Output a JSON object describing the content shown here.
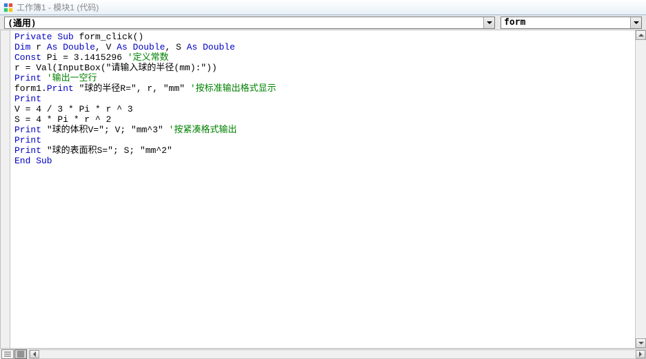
{
  "title": "工作簿1 - 模块1 (代码)",
  "object_dropdown": "(通用)",
  "procedure_dropdown": "form",
  "code_lines": [
    [
      {
        "t": "Private Sub",
        "c": "kw"
      },
      {
        "t": " form_click()",
        "c": ""
      }
    ],
    [
      {
        "t": "Dim",
        "c": "kw"
      },
      {
        "t": " r ",
        "c": ""
      },
      {
        "t": "As Double",
        "c": "kw"
      },
      {
        "t": ", V ",
        "c": ""
      },
      {
        "t": "As Double",
        "c": "kw"
      },
      {
        "t": ", S ",
        "c": ""
      },
      {
        "t": "As Double",
        "c": "kw"
      }
    ],
    [
      {
        "t": "Const",
        "c": "kw"
      },
      {
        "t": " Pi = 3.1415296 ",
        "c": ""
      },
      {
        "t": "'定义常数",
        "c": "cm"
      }
    ],
    [
      {
        "t": "r = Val(InputBox(\"请输入球的半径(mm):\"))",
        "c": ""
      }
    ],
    [
      {
        "t": "Print",
        "c": "kw"
      },
      {
        "t": " ",
        "c": ""
      },
      {
        "t": "'输出一空行",
        "c": "cm"
      }
    ],
    [
      {
        "t": "form1.",
        "c": ""
      },
      {
        "t": "Print",
        "c": "kw"
      },
      {
        "t": " \"球的半径R=\", r, \"mm\" ",
        "c": ""
      },
      {
        "t": "'按标准输出格式显示",
        "c": "cm"
      }
    ],
    [
      {
        "t": "Print",
        "c": "kw"
      }
    ],
    [
      {
        "t": "V = 4 / 3 * Pi * r ^ 3",
        "c": ""
      }
    ],
    [
      {
        "t": "S = 4 * Pi * r ^ 2",
        "c": ""
      }
    ],
    [
      {
        "t": "Print",
        "c": "kw"
      },
      {
        "t": " \"球的体积V=\"; V; \"mm^3\" ",
        "c": ""
      },
      {
        "t": "'按紧凑格式输出",
        "c": "cm"
      }
    ],
    [
      {
        "t": "Print",
        "c": "kw"
      }
    ],
    [
      {
        "t": "Print",
        "c": "kw"
      },
      {
        "t": " \"球的表面积S=\"; S; \"mm^2\"",
        "c": ""
      }
    ],
    [
      {
        "t": "End Sub",
        "c": "kw"
      }
    ]
  ]
}
